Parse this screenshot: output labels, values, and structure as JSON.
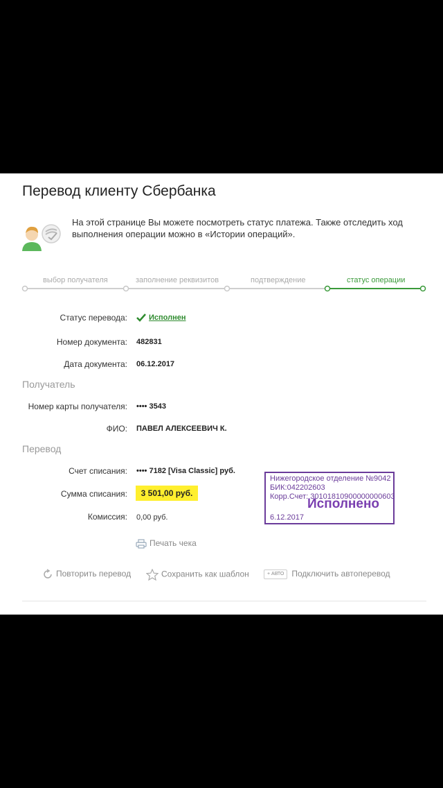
{
  "page": {
    "title": "Перевод клиенту Сбербанка",
    "info_text": "На этой странице Вы можете посмотреть статус платежа. Также отследить ход выполнения операции можно в «Истории операций»."
  },
  "steps": [
    {
      "label": "выбор получателя",
      "active": false
    },
    {
      "label": "заполнение реквизитов",
      "active": false
    },
    {
      "label": "подтверждение",
      "active": false
    },
    {
      "label": "статус операции",
      "active": true
    }
  ],
  "details": {
    "status_label": "Статус перевода:",
    "status_value": "Исполнен",
    "doc_number_label": "Номер документа:",
    "doc_number_value": "482831",
    "doc_date_label": "Дата документа:",
    "doc_date_value": "06.12.2017"
  },
  "recipient": {
    "section_title": "Получатель",
    "card_label": "Номер карты получателя:",
    "card_value": "•••• 3543",
    "name_label": "ФИО:",
    "name_value": "ПАВЕЛ АЛЕКСЕЕВИЧ К."
  },
  "transfer": {
    "section_title": "Перевод",
    "account_label": "Счет списания:",
    "account_value": "•••• 7182  [Visa Classic]  руб.",
    "amount_label": "Сумма списания:",
    "amount_value": "3 501,00  руб.",
    "fee_label": "Комиссия:",
    "fee_value": "0,00 руб."
  },
  "stamp": {
    "line1": "Нижегородское отделение №9042",
    "line2": "БИК:042202603",
    "line3": "Корр.Счет: 30101810900000000603",
    "status": "Исполнено",
    "date": "6.12.2017"
  },
  "actions": {
    "print": "Печать чека",
    "repeat": "Повторить перевод",
    "save_template": "Сохранить как шаблон",
    "auto_badge": "АВТО",
    "auto_transfer": "Подключить автоперевод"
  },
  "colors": {
    "accent_green": "#3a9a3a",
    "highlight_yellow": "#ffef2e",
    "stamp_purple": "#6a3b9a"
  }
}
